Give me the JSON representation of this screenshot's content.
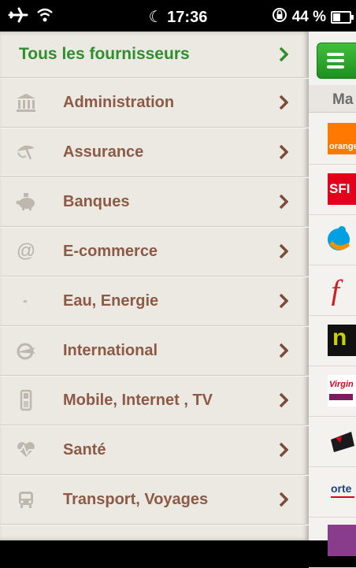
{
  "status_bar": {
    "time": "17:36",
    "battery_text": "44 %",
    "battery_level": 0.44
  },
  "menu": {
    "header_label": "Tous les fournisseurs",
    "items": [
      {
        "label": "Administration",
        "icon": "bank-icon"
      },
      {
        "label": "Assurance",
        "icon": "umbrella-icon"
      },
      {
        "label": "Banques",
        "icon": "piggy-bank-icon"
      },
      {
        "label": "E-commerce",
        "icon": "at-sign-icon"
      },
      {
        "label": "Eau, Energie",
        "icon": "lightning-icon"
      },
      {
        "label": "International",
        "icon": "globe-plane-icon"
      },
      {
        "label": "Mobile, Internet , TV",
        "icon": "mobile-phone-icon"
      },
      {
        "label": "Santé",
        "icon": "heartbeat-icon"
      },
      {
        "label": "Transport, Voyages",
        "icon": "bus-icon"
      }
    ]
  },
  "panel": {
    "tab_label": "Ma",
    "logos": [
      {
        "name": "orange-logo",
        "text": "orange"
      },
      {
        "name": "sfr-logo",
        "text": "SFI"
      },
      {
        "name": "bouygues-logo",
        "text": ""
      },
      {
        "name": "free-logo",
        "text": "f"
      },
      {
        "name": "numericable-logo",
        "text": "n"
      },
      {
        "name": "virgin-mobile-logo",
        "text": "Virgin"
      },
      {
        "name": "nrj-mobile-logo",
        "text": ""
      },
      {
        "name": "ortel-mobile-logo",
        "text": "orte"
      },
      {
        "name": "partial-logo",
        "text": ""
      }
    ]
  },
  "colors": {
    "header_green": "#2f8f2e",
    "item_brown": "#8c5a45",
    "button_green": "#2fae2c"
  }
}
